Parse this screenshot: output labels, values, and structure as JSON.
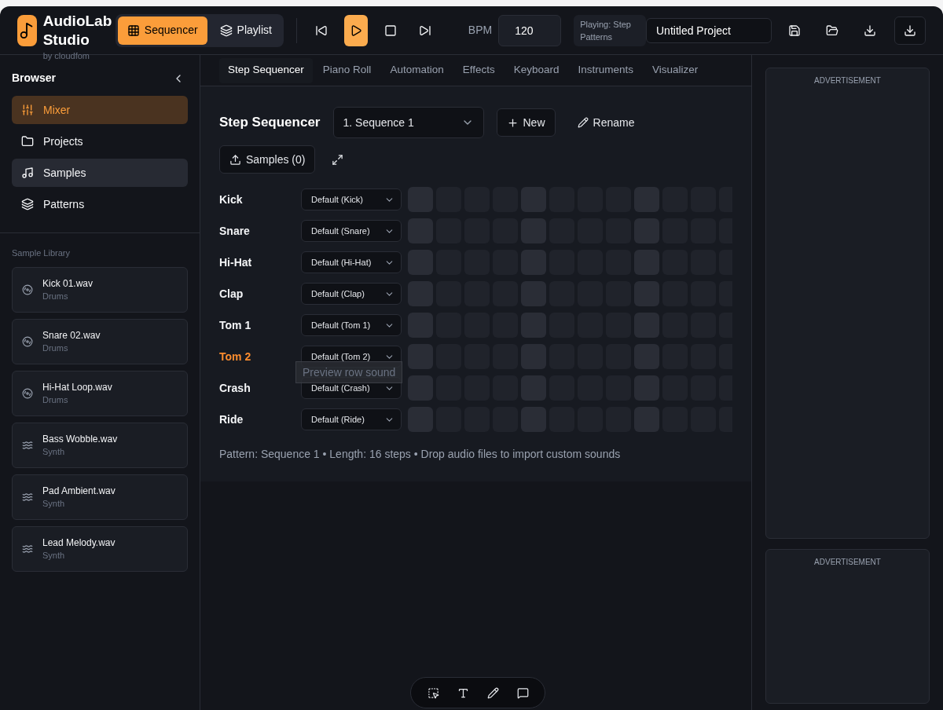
{
  "app": {
    "title": "AudioLab Studio",
    "byline": "by cloudfom"
  },
  "view_tabs": [
    {
      "label": "Sequencer",
      "selected": true
    },
    {
      "label": "Playlist",
      "selected": false
    }
  ],
  "transport": [
    {
      "selected": false
    },
    {
      "selected": true
    },
    {
      "selected": false
    },
    {
      "selected": false
    }
  ],
  "bpm": {
    "label": "BPM",
    "value": "120"
  },
  "status": "Playing: Step Patterns",
  "project_name": "Untitled Project",
  "header_actions": [
    {
      "bordered": false
    },
    {
      "bordered": false
    },
    {
      "bordered": false
    },
    {
      "bordered": true
    }
  ],
  "sidebar": {
    "title": "Browser",
    "items": [
      {
        "label": "Mixer",
        "selected": true,
        "hovered": false
      },
      {
        "label": "Projects",
        "selected": false,
        "hovered": false
      },
      {
        "label": "Samples",
        "selected": false,
        "hovered": true
      },
      {
        "label": "Patterns",
        "selected": false,
        "hovered": false
      }
    ],
    "library_title": "Sample Library",
    "samples": [
      {
        "name": "Kick 01.wav",
        "category": "Drums",
        "kind": "disc"
      },
      {
        "name": "Snare 02.wav",
        "category": "Drums",
        "kind": "disc"
      },
      {
        "name": "Hi-Hat Loop.wav",
        "category": "Drums",
        "kind": "disc"
      },
      {
        "name": "Bass Wobble.wav",
        "category": "Synth",
        "kind": "wave"
      },
      {
        "name": "Pad Ambient.wav",
        "category": "Synth",
        "kind": "wave"
      },
      {
        "name": "Lead Melody.wav",
        "category": "Synth",
        "kind": "wave"
      }
    ]
  },
  "tabs": [
    {
      "label": "Step Sequencer",
      "selected": true
    },
    {
      "label": "Piano Roll",
      "selected": false
    },
    {
      "label": "Automation",
      "selected": false
    },
    {
      "label": "Effects",
      "selected": false
    },
    {
      "label": "Keyboard",
      "selected": false
    },
    {
      "label": "Instruments",
      "selected": false
    },
    {
      "label": "Visualizer",
      "selected": false
    }
  ],
  "sequencer": {
    "title": "Step Sequencer",
    "sequence": "1. Sequence 1",
    "new_button": "New",
    "rename_button": "Rename",
    "samples_button": "Samples (0)",
    "tracks": [
      {
        "name": "Kick",
        "sound": "Default (Kick)",
        "selected": false
      },
      {
        "name": "Snare",
        "sound": "Default (Snare)",
        "selected": false
      },
      {
        "name": "Hi-Hat",
        "sound": "Default (Hi-Hat)",
        "selected": false
      },
      {
        "name": "Clap",
        "sound": "Default (Clap)",
        "selected": false
      },
      {
        "name": "Tom 1",
        "sound": "Default (Tom 1)",
        "selected": false
      },
      {
        "name": "Tom 2",
        "sound": "Default (Tom 2)",
        "selected": true
      },
      {
        "name": "Crash",
        "sound": "Default (Crash)",
        "selected": false
      },
      {
        "name": "Ride",
        "sound": "Default (Ride)",
        "selected": false
      }
    ],
    "tooltip": "Preview row sound",
    "footer": "Pattern: Sequence 1 • Length: 16 steps • Drop audio files to import custom sounds"
  },
  "ads": [
    {
      "label": "ADVERTISEMENT"
    },
    {
      "label": "ADVERTISEMENT"
    }
  ]
}
